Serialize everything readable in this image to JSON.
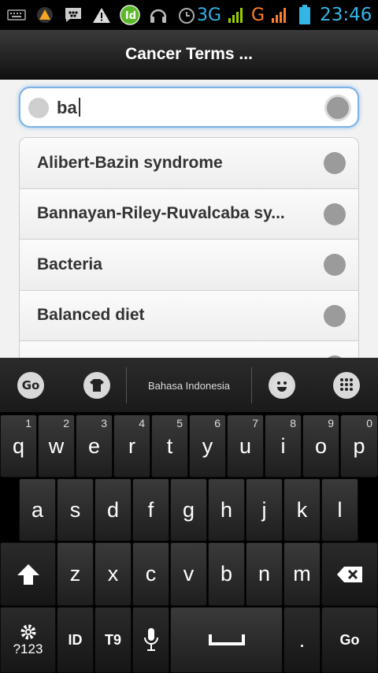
{
  "status_bar": {
    "network_3g": "3G",
    "network_g": "G",
    "time": "23:46",
    "accent": "#33b5e5"
  },
  "header": {
    "title": "Cancer Terms ..."
  },
  "search": {
    "value": "ba"
  },
  "results": [
    {
      "label": "Alibert-Bazin syndrome"
    },
    {
      "label": "Bannayan-Riley-Ruvalcaba sy..."
    },
    {
      "label": "Bacteria"
    },
    {
      "label": "Balanced diet"
    },
    {
      "label": ""
    }
  ],
  "keyboard": {
    "go_logo": "Go",
    "language": "Bahasa Indonesia",
    "row1": [
      {
        "letter": "q",
        "num": "1"
      },
      {
        "letter": "w",
        "num": "2"
      },
      {
        "letter": "e",
        "num": "3"
      },
      {
        "letter": "r",
        "num": "4"
      },
      {
        "letter": "t",
        "num": "5"
      },
      {
        "letter": "y",
        "num": "6"
      },
      {
        "letter": "u",
        "num": "7"
      },
      {
        "letter": "i",
        "num": "8"
      },
      {
        "letter": "o",
        "num": "9"
      },
      {
        "letter": "p",
        "num": "0"
      }
    ],
    "row2": [
      "a",
      "s",
      "d",
      "f",
      "g",
      "h",
      "j",
      "k",
      "l"
    ],
    "row3": [
      "z",
      "x",
      "c",
      "v",
      "b",
      "n",
      "m"
    ],
    "mode_label": "?123",
    "id_label": "ID",
    "t9_label": "T9",
    "period_label": ".",
    "go_label": "Go"
  }
}
